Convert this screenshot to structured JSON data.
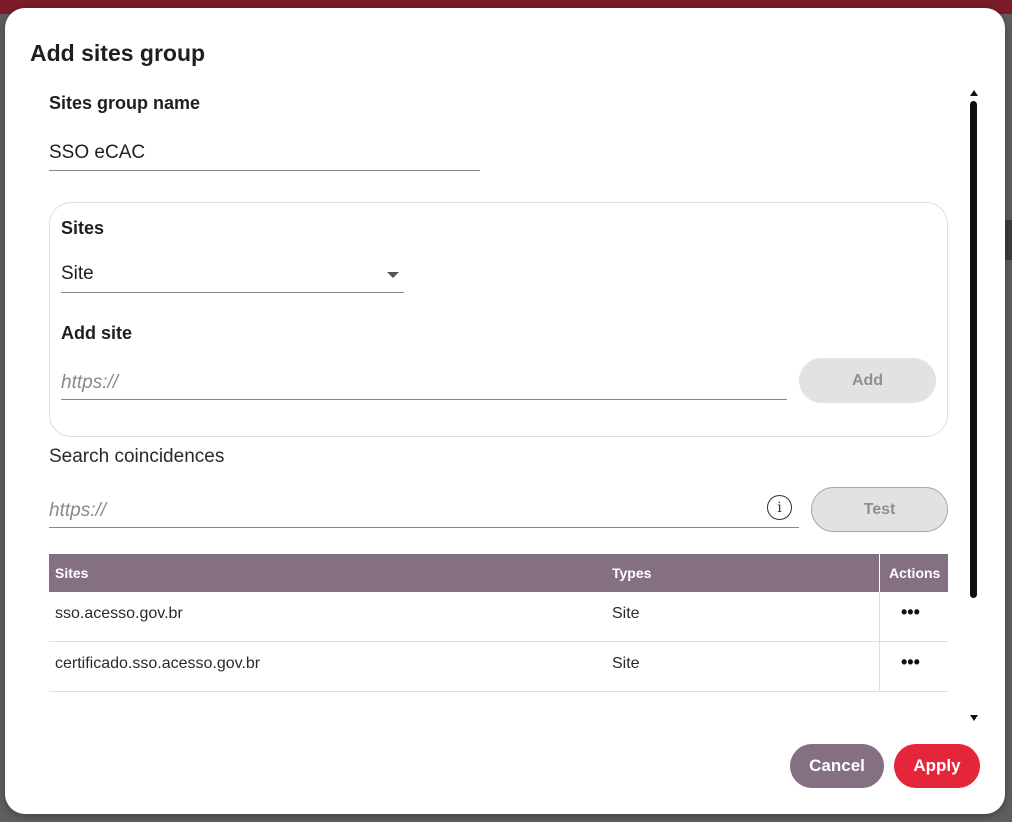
{
  "modal": {
    "title": "Add sites group"
  },
  "group_name": {
    "label": "Sites group name",
    "value": "SSO eCAC"
  },
  "sites": {
    "label": "Sites",
    "type_selected": "Site",
    "add_site_label": "Add site",
    "add_site_placeholder": "https://",
    "add_button": "Add"
  },
  "search": {
    "label": "Search coincidences",
    "placeholder": "https://",
    "info_icon": "i",
    "test_button": "Test"
  },
  "table": {
    "columns": [
      "Sites",
      "Types",
      "Actions"
    ],
    "rows": [
      {
        "site": "sso.acesso.gov.br",
        "type": "Site",
        "actions": "•••"
      },
      {
        "site": "certificado.sso.acesso.gov.br",
        "type": "Site",
        "actions": "•••"
      }
    ]
  },
  "footer": {
    "cancel": "Cancel",
    "apply": "Apply"
  },
  "colors": {
    "primary_muted": "#857081",
    "accent": "#e5263a",
    "disabled": "#e2e2e2"
  },
  "icons": {
    "info": "info-icon",
    "dropdown": "chevron-down-icon",
    "row_actions": "more-horizontal-icon"
  }
}
